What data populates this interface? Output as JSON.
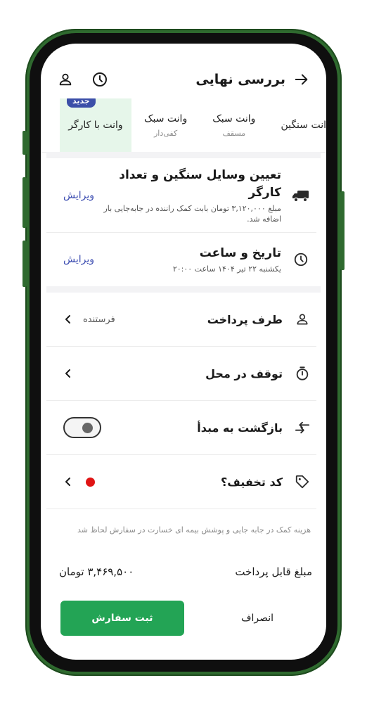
{
  "header": {
    "title": "بررسی نهایی"
  },
  "tabs": [
    {
      "label": "انت سنگین",
      "sub": ""
    },
    {
      "label": "وانت سبک",
      "sub": "مسقف"
    },
    {
      "label": "وانت سبک",
      "sub": "کفی‌دار"
    },
    {
      "label": "وانت با کارگر",
      "sub": "",
      "badge": "جدید",
      "active": true
    }
  ],
  "service": {
    "title": "تعیین وسایل سنگین و تعداد کارگر",
    "subtitle": "مبلغ ۳,۱۲۰,۰۰۰ تومان بابت کمک راننده در جابه‌جایی بار اضافه شد.",
    "edit_label": "ویرایش"
  },
  "datetime": {
    "title": "تاریخ و ساعت",
    "subtitle": "یکشنبه ۲۲ تیر ۱۴۰۴ ساعت ۲۰:۰۰",
    "edit_label": "ویرایش"
  },
  "payer": {
    "title": "طرف پرداخت",
    "value": "فرستنده"
  },
  "stop": {
    "title": "توقف در محل"
  },
  "return": {
    "title": "بازگشت به مبدأ",
    "enabled": false
  },
  "discount": {
    "title": "کد تخفیف؟"
  },
  "note": "هزینه کمک در جابه جایی و پوشش بیمه ای خسارت در سفارش لحاظ شد",
  "total": {
    "label": "مبلغ قابل پرداخت",
    "value": "۳,۴۶۹,۵۰۰ تومان"
  },
  "actions": {
    "submit_label": "ثبت سفارش",
    "cancel_label": "انصراف"
  },
  "colors": {
    "accent": "#23a455",
    "link": "#3a4bb0",
    "badge": "#3b4fa8",
    "frame": "#2f6a2f",
    "alert": "#e01414"
  }
}
